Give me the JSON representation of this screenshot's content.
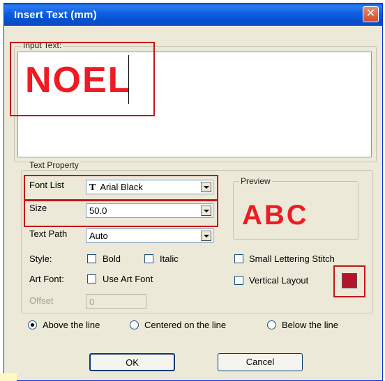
{
  "window": {
    "title": "Insert Text   (mm)",
    "close_symbol": "✕"
  },
  "input_text": {
    "group_label": "Input Text:",
    "value": "NOEL",
    "value_color": "#ee1b24"
  },
  "text_property": {
    "group_label": "Text Property",
    "font_list": {
      "label": "Font List",
      "value": "Arial Black",
      "icon_glyph": "T"
    },
    "size": {
      "label": "Size",
      "value": "50.0"
    },
    "text_path": {
      "label": "Text Path",
      "value": "Auto"
    },
    "style": {
      "label": "Style:",
      "bold": "Bold",
      "italic": "Italic",
      "small_lettering": "Small Lettering Stitch"
    },
    "art_font": {
      "label": "Art Font:",
      "use_art_font": "Use Art Font",
      "vertical_layout": "Vertical Layout"
    },
    "offset": {
      "label": "Offset",
      "value": "0"
    },
    "color_swatch": "#b5142a",
    "position": {
      "above": "Above the line",
      "centered": "Centered on the line",
      "below": "Below the line",
      "selected": "above"
    }
  },
  "preview": {
    "label": "Preview",
    "text": "ABC",
    "color": "#ee1b24"
  },
  "buttons": {
    "ok": "OK",
    "cancel": "Cancel"
  },
  "annotation_color": "#c21818"
}
